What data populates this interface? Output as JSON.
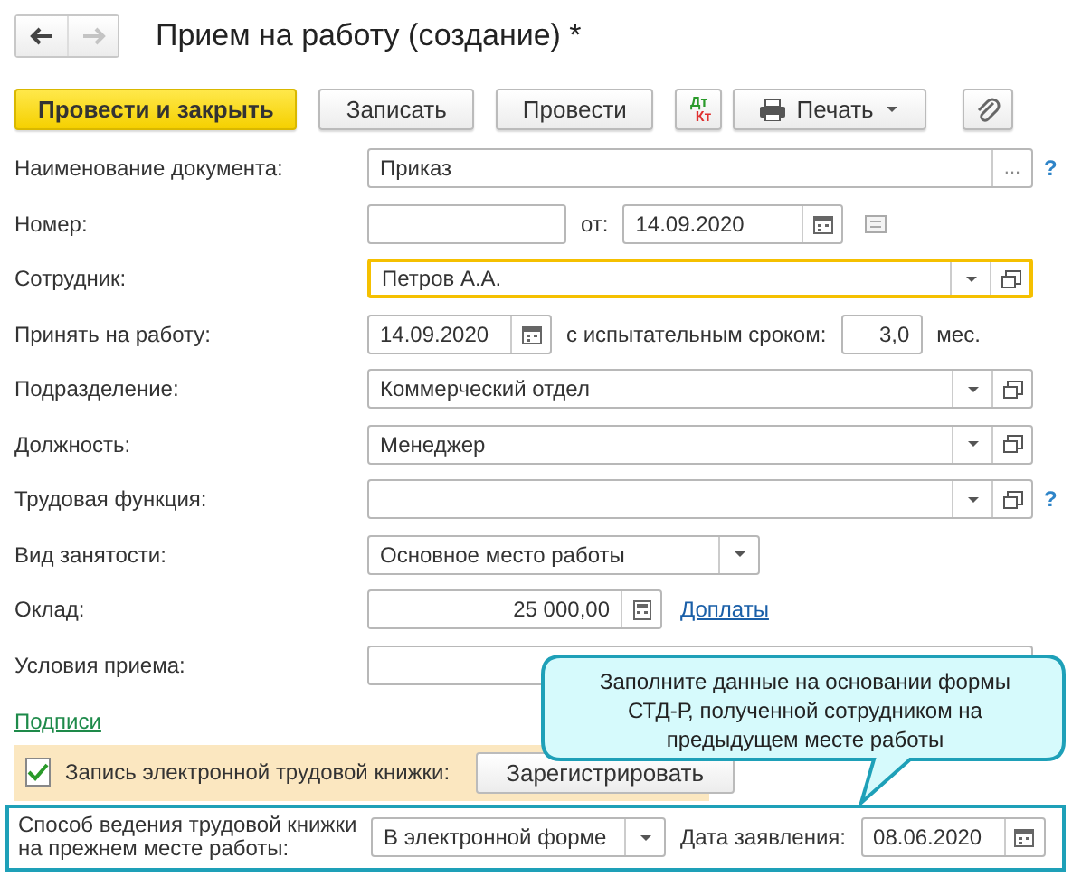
{
  "navigation": {
    "back_enabled": true,
    "forward_enabled": false
  },
  "window": {
    "title": "Прием на работу (создание) *"
  },
  "toolbar": [
    {
      "kind": "primary",
      "label": "Провести и закрыть"
    },
    {
      "kind": "button",
      "label": "Записать"
    },
    {
      "kind": "button",
      "label": "Провести"
    },
    {
      "kind": "dtkt",
      "top": "Дт",
      "bottom": "Кт"
    },
    {
      "kind": "menu",
      "label": "Печать"
    },
    {
      "kind": "attach"
    }
  ],
  "rows": [
    {
      "kind": "text",
      "label": "Наименование документа:",
      "value": "Приказ",
      "select_button": "...",
      "help": "?"
    },
    {
      "kind": "number",
      "label": "Номер:",
      "date_label": "от:",
      "date": "14.09.2020"
    },
    {
      "kind": "ref",
      "label": "Сотрудник:",
      "value": "Петров А.А.",
      "focused": true
    },
    {
      "kind": "hire",
      "label": "Принять на работу:",
      "date": "14.09.2020",
      "probation_label": "с испытательным сроком:",
      "probation": "3,0",
      "unit": "мес."
    },
    {
      "kind": "ref",
      "label": "Подразделение:",
      "value": "Коммерческий отдел",
      "focused": false
    },
    {
      "kind": "ref",
      "label": "Должность:",
      "value": "Менеджер",
      "focused": false
    },
    {
      "kind": "ref",
      "label": "Трудовая функция:",
      "focused": false,
      "help": "?"
    },
    {
      "kind": "combo",
      "label": "Вид занятости:",
      "value": "Основное место работы"
    },
    {
      "kind": "amount",
      "label": "Оклад:",
      "value": "25 000,00",
      "link": "Доплаты"
    },
    {
      "kind": "plain",
      "label": "Условия приема:"
    }
  ],
  "signatures_link": "Подписи",
  "electronic_book": {
    "checked": true,
    "label": "Запись электронной трудовой книжки:",
    "button": "Зарегистрировать"
  },
  "previous_job": {
    "highlighted": true,
    "label": "Способ ведения трудовой книжки на прежнем месте работы:",
    "value": "В электронной форме",
    "date_label": "Дата заявления:",
    "date": "08.06.2020"
  },
  "callout": {
    "text": "Заполните данные на основании формы СТД-Р, полученной сотрудником на предыдущем месте работы"
  }
}
